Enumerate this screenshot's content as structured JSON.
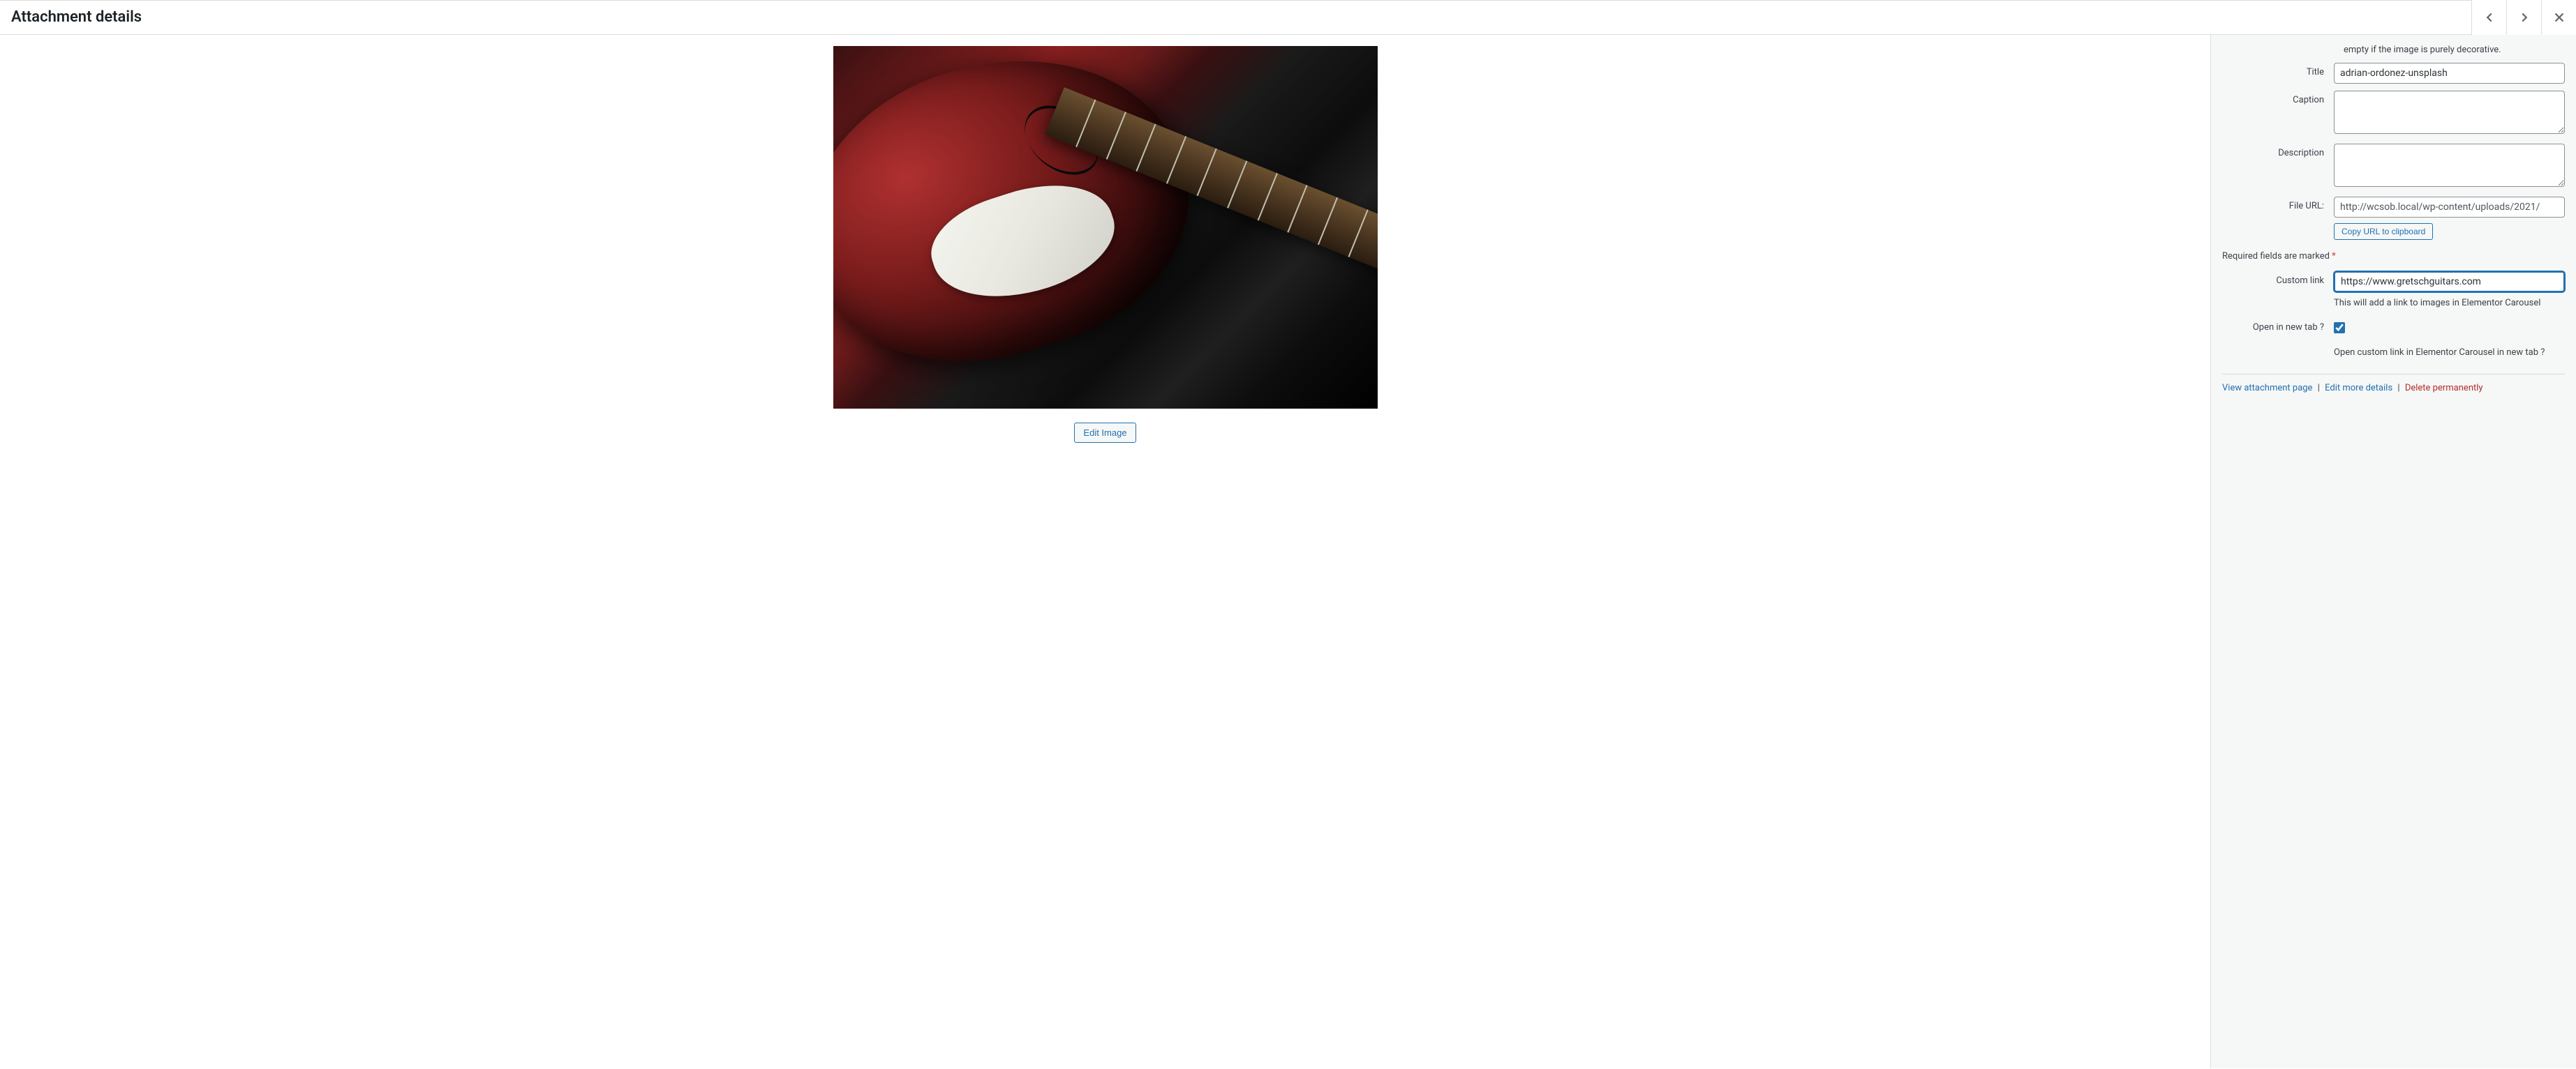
{
  "header": {
    "title": "Attachment details"
  },
  "preview": {
    "edit_image_label": "Edit Image"
  },
  "sidebar": {
    "alt_helper_tail": "empty if the image is purely decorative.",
    "labels": {
      "title": "Title",
      "caption": "Caption",
      "description": "Description",
      "file_url": "File URL:",
      "custom_link": "Custom link",
      "open_new_tab": "Open in new tab ?"
    },
    "values": {
      "title": "adrian-ordonez-unsplash",
      "caption": "",
      "description": "",
      "file_url": "http://wcsob.local/wp-content/uploads/2021/",
      "custom_link": "https://www.gretschguitars.com",
      "open_new_tab": true
    },
    "copy_url_label": "Copy URL to clipboard",
    "required_note": "Required fields are marked",
    "required_star": "*",
    "custom_link_help": "This will add a link to images in Elementor Carousel",
    "open_new_tab_help": "Open custom link in Elementor Carousel in new tab ?",
    "links": {
      "view": "View attachment page",
      "edit": "Edit more details",
      "delete": "Delete permanently"
    }
  }
}
